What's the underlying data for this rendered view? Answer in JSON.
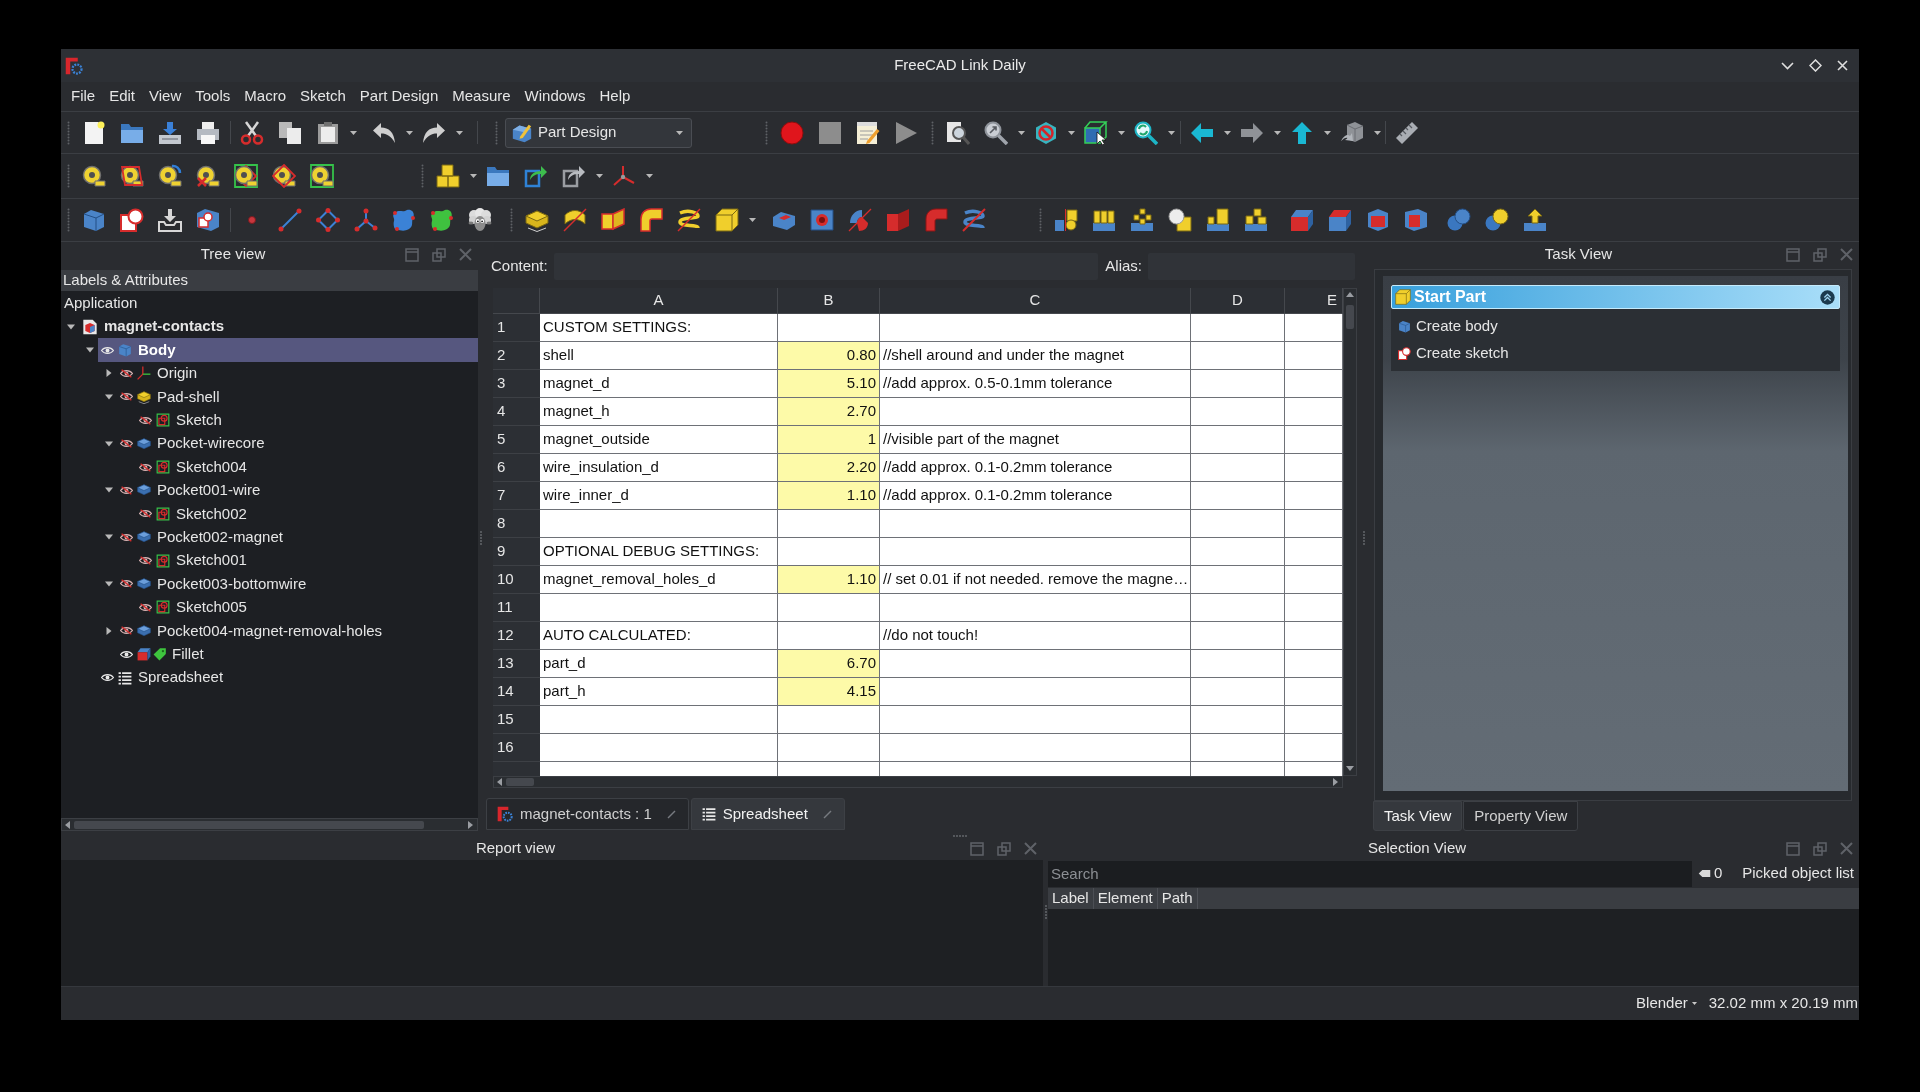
{
  "window": {
    "title": "FreeCAD Link Daily"
  },
  "menu": [
    "File",
    "Edit",
    "View",
    "Tools",
    "Macro",
    "Sketch",
    "Part Design",
    "Measure",
    "Windows",
    "Help"
  ],
  "toolbar": {
    "workbench": "Part Design"
  },
  "tree_view": {
    "title": "Tree view",
    "header": "Labels & Attributes",
    "root": "Application",
    "items": [
      {
        "label": "magnet-contacts",
        "kind": "document",
        "expanded": true,
        "selected": false,
        "active": true,
        "children": [
          {
            "label": "Body",
            "kind": "body",
            "expanded": true,
            "visible": true,
            "selected": true,
            "active": true,
            "children": [
              {
                "label": "Origin",
                "kind": "origin",
                "expanded": false,
                "visible": false,
                "selected": false,
                "active": false
              },
              {
                "label": "Pad-shell",
                "kind": "pad",
                "expanded": true,
                "visible": false,
                "selected": false,
                "active": false,
                "children": [
                  {
                    "label": "Sketch",
                    "kind": "sketch",
                    "visible": false,
                    "selected": false,
                    "active": false
                  }
                ]
              },
              {
                "label": "Pocket-wirecore",
                "kind": "pocket",
                "expanded": true,
                "visible": false,
                "selected": false,
                "active": false,
                "children": [
                  {
                    "label": "Sketch004",
                    "kind": "sketch",
                    "visible": false,
                    "selected": false,
                    "active": false
                  }
                ]
              },
              {
                "label": "Pocket001-wire",
                "kind": "pocket",
                "expanded": true,
                "visible": false,
                "selected": false,
                "active": false,
                "children": [
                  {
                    "label": "Sketch002",
                    "kind": "sketch",
                    "visible": false,
                    "selected": false,
                    "active": false
                  }
                ]
              },
              {
                "label": "Pocket002-magnet",
                "kind": "pocket",
                "expanded": true,
                "visible": false,
                "selected": false,
                "active": false,
                "children": [
                  {
                    "label": "Sketch001",
                    "kind": "sketch",
                    "visible": false,
                    "selected": false,
                    "active": false
                  }
                ]
              },
              {
                "label": "Pocket003-bottomwire",
                "kind": "pocket",
                "expanded": true,
                "visible": false,
                "selected": false,
                "active": false,
                "children": [
                  {
                    "label": "Sketch005",
                    "kind": "sketch",
                    "visible": false,
                    "selected": false,
                    "active": false
                  }
                ]
              },
              {
                "label": "Pocket004-magnet-removal-holes",
                "kind": "pocket",
                "expanded": false,
                "visible": false,
                "selected": false,
                "active": false
              },
              {
                "label": "Fillet",
                "kind": "fillet",
                "visible": true,
                "selected": false,
                "active": false
              }
            ]
          },
          {
            "label": "Spreadsheet",
            "kind": "spreadsheet",
            "visible": true,
            "selected": false,
            "active": false
          }
        ]
      }
    ]
  },
  "editor": {
    "content_label": "Content:",
    "alias_label": "Alias:",
    "columns": [
      "A",
      "B",
      "C",
      "D",
      "E"
    ],
    "rows": [
      {
        "label": "1",
        "cells": {
          "a": "CUSTOM SETTINGS:"
        },
        "highlighted": false
      },
      {
        "label": "2",
        "cells": {
          "a": "shell",
          "b": "0.80",
          "c": "//shell around and under the magnet"
        },
        "highlighted": true
      },
      {
        "label": "3",
        "cells": {
          "a": "magnet_d",
          "b": "5.10",
          "c": "//add approx. 0.5-0.1mm tolerance"
        },
        "highlighted": true
      },
      {
        "label": "4",
        "cells": {
          "a": "magnet_h",
          "b": "2.70"
        },
        "highlighted": true
      },
      {
        "label": "5",
        "cells": {
          "a": "magnet_outside",
          "b": "1",
          "c": "//visible part of the magnet"
        },
        "highlighted": true
      },
      {
        "label": "6",
        "cells": {
          "a": "wire_insulation_d",
          "b": "2.20",
          "c": "//add approx. 0.1-0.2mm tolerance"
        },
        "highlighted": true
      },
      {
        "label": "7",
        "cells": {
          "a": "wire_inner_d",
          "b": "1.10",
          "c": "//add approx. 0.1-0.2mm tolerance"
        },
        "highlighted": true
      },
      {
        "label": "8",
        "highlighted": false
      },
      {
        "label": "9",
        "cells": {
          "a": "OPTIONAL DEBUG SETTINGS:"
        },
        "highlighted": false
      },
      {
        "label": "10",
        "cells": {
          "a": "magnet_removal_holes_d",
          "b": "1.10",
          "c": "// set 0.01 if not needed. remove the magne…"
        },
        "highlighted": true
      },
      {
        "label": "11",
        "highlighted": false
      },
      {
        "label": "12",
        "cells": {
          "a": "AUTO CALCULATED:",
          "c": "//do not touch!"
        },
        "highlighted": false
      },
      {
        "label": "13",
        "cells": {
          "a": "part_d",
          "b": "6.70"
        },
        "highlighted": true
      },
      {
        "label": "14",
        "cells": {
          "a": "part_h",
          "b": "4.15"
        },
        "highlighted": true
      },
      {
        "label": "15",
        "highlighted": false
      },
      {
        "label": "16",
        "highlighted": false
      }
    ],
    "tabs": [
      {
        "label": "magnet-contacts : 1",
        "kind": "document",
        "selected": false
      },
      {
        "label": "Spreadsheet",
        "kind": "spreadsheet",
        "selected": true
      }
    ]
  },
  "task_view": {
    "title": "Task View",
    "panel": {
      "title": "Start Part",
      "items": [
        {
          "label": "Create body",
          "kind": "body"
        },
        {
          "label": "Create sketch",
          "kind": "sketch"
        }
      ]
    },
    "tabs": [
      {
        "label": "Task View",
        "selected": true
      },
      {
        "label": "Property View",
        "selected": false
      }
    ]
  },
  "report_view": {
    "title": "Report view"
  },
  "selection_view": {
    "title": "Selection View",
    "search": {
      "placeholder": "Search"
    },
    "count": "0",
    "picked_label": "Picked object list",
    "columns": [
      "Label",
      "Element",
      "Path"
    ]
  },
  "status_bar": {
    "navigation": "Blender",
    "dimensions": "32.02 mm x 20.19 mm"
  }
}
